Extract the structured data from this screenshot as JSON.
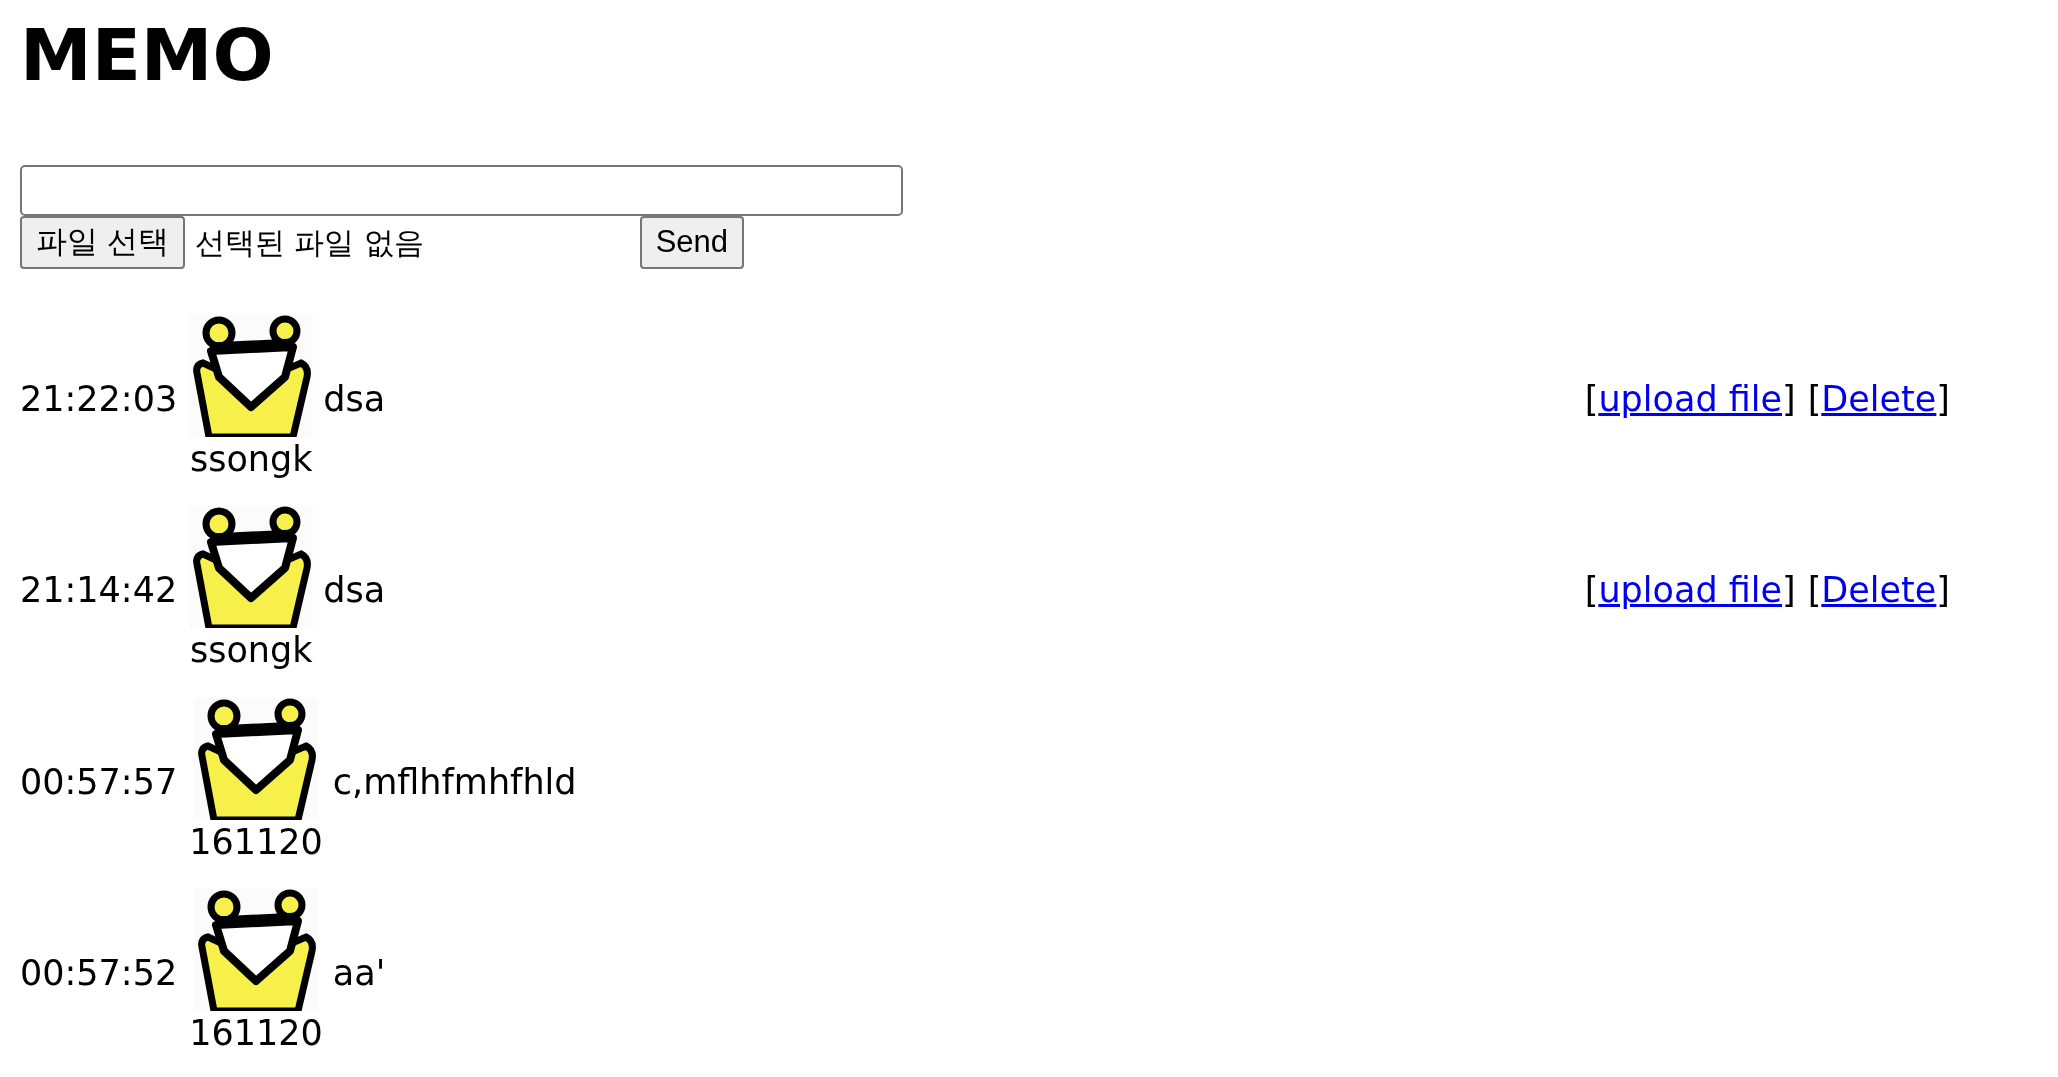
{
  "title": "MEMO",
  "form": {
    "file_button": "파일 선택",
    "file_status": "선택된 파일 없음",
    "send_button": "Send"
  },
  "memos": [
    {
      "time": "21:22:03",
      "user": "ssongk",
      "message": "dsa",
      "actions": [
        {
          "prefix": "[",
          "label": "upload file",
          "suffix": "]"
        },
        {
          "prefix": "[",
          "label": "Delete",
          "suffix": "]"
        }
      ]
    },
    {
      "time": "21:14:42",
      "user": "ssongk",
      "message": "dsa",
      "actions": [
        {
          "prefix": "[",
          "label": "upload file",
          "suffix": "]"
        },
        {
          "prefix": "[",
          "label": "Delete",
          "suffix": "]"
        }
      ]
    },
    {
      "time": "00:57:57",
      "user": "161120",
      "message": "c,mflhfmhfhld"
    },
    {
      "time": "00:57:52",
      "user": "161120",
      "message": "aa'"
    }
  ]
}
